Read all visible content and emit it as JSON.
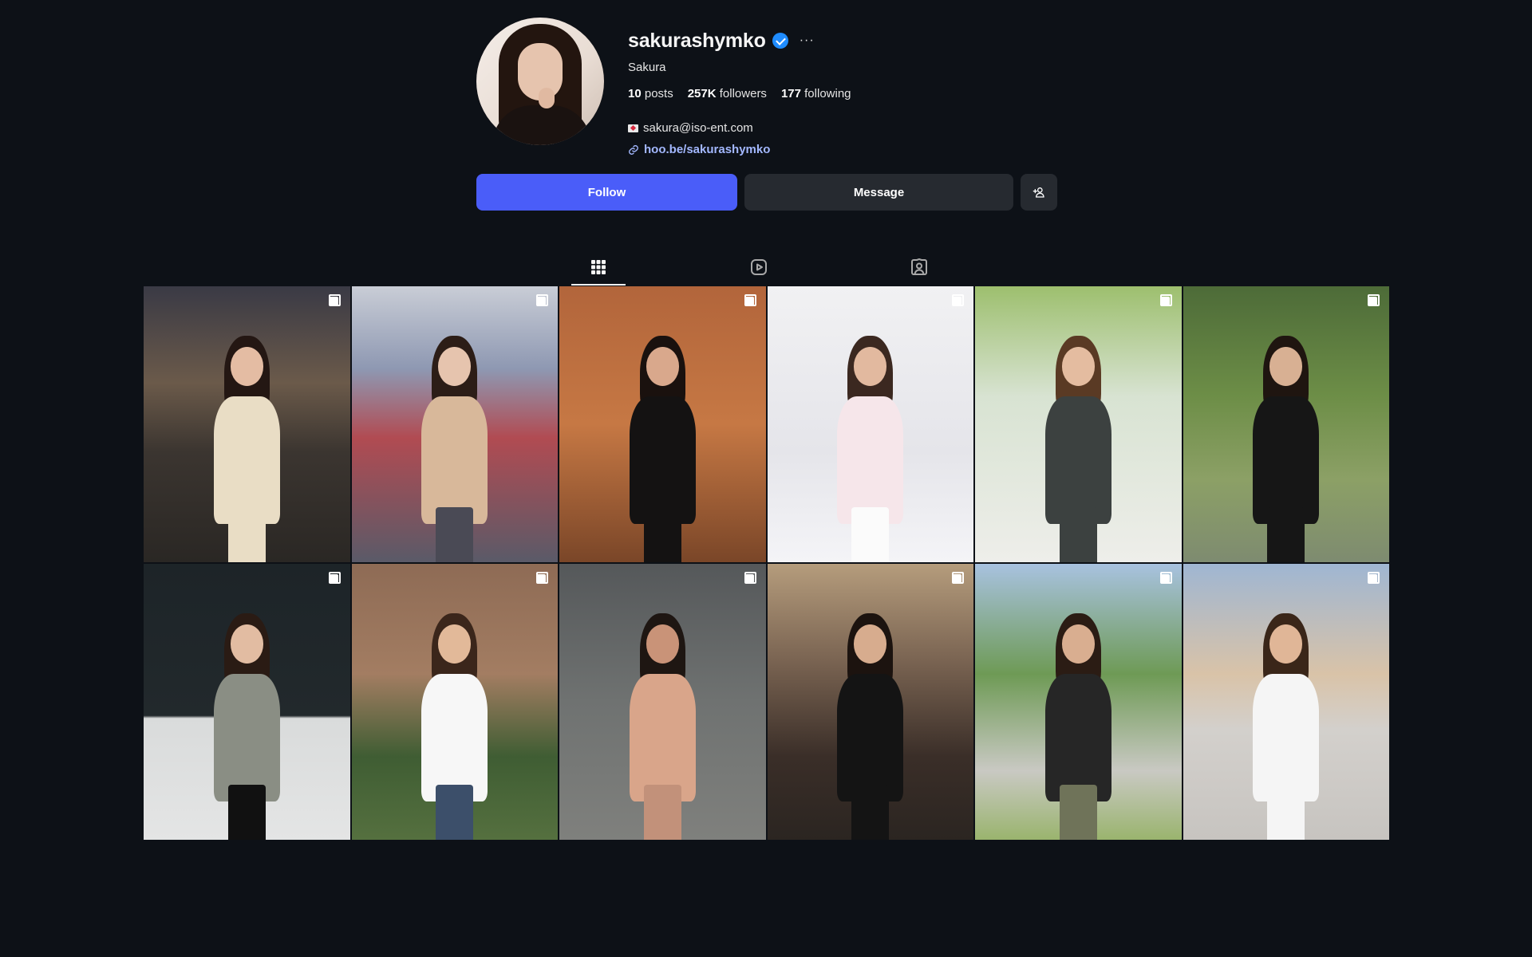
{
  "profile": {
    "username": "sakurashymko",
    "full_name": "Sakura",
    "more_label": "···",
    "stats": {
      "posts_count": "10",
      "posts_label": "posts",
      "followers_count": "257K",
      "followers_label": "followers",
      "following_count": "177",
      "following_label": "following"
    },
    "email": "sakura@iso-ent.com",
    "link": "hoo.be/sakurashymko"
  },
  "actions": {
    "follow_label": "Follow",
    "message_label": "Message"
  },
  "tabs": [
    {
      "name": "posts",
      "icon": "grid-icon",
      "active": true
    },
    {
      "name": "reels",
      "icon": "reels-icon",
      "active": false
    },
    {
      "name": "tagged",
      "icon": "tagged-icon",
      "active": false
    }
  ],
  "colors": {
    "background": "#0d1117",
    "follow_button": "#4a5df9",
    "secondary_button": "#262a30",
    "link": "#a3b8ff",
    "verified": "#1f8cff"
  },
  "posts": [
    {
      "bg": "linear-gradient(180deg,#3a3a45 0%,#6b5a4a 35%,#3b3530 60%,#2a2724 100%)",
      "hair": "#241713",
      "skin": "#e4bca3",
      "top": "#e9ddc5",
      "bottom": "#e9ddc5",
      "multi": true
    },
    {
      "bg": "linear-gradient(180deg,#c9cdd6 0%,#8e98b2 30%,#b14b52 55%,#5a5a68 100%)",
      "hair": "#2c1d17",
      "skin": "#e6c4ae",
      "top": "#d8b89a",
      "bottom": "#4a4a55",
      "multi": true
    },
    {
      "bg": "linear-gradient(180deg,#b2653b 0%,#c67844 50%,#7a4628 100%)",
      "hair": "#1a110e",
      "skin": "#d9a88c",
      "top": "#141212",
      "bottom": "#141212",
      "multi": true
    },
    {
      "bg": "linear-gradient(180deg,#f1f1f3 0%,#e5e5ea 60%,#f4f4f7 100%)",
      "hair": "#3b2820",
      "skin": "#e2b99f",
      "top": "#f6e6ea",
      "bottom": "#fbfbfb",
      "multi": true
    },
    {
      "bg": "linear-gradient(180deg,#9dbf6e 0%,#d8e3d2 40%,#eeeeea 100%)",
      "hair": "#5a3a24",
      "skin": "#e4bca0",
      "top": "#3c4140",
      "bottom": "#3c4140",
      "multi": true
    },
    {
      "bg": "linear-gradient(180deg,#4d6b38 0%,#6d8e47 40%,#8ca066 70%,#7e8b70 100%)",
      "hair": "#1f1510",
      "skin": "#d8b093",
      "top": "#161616",
      "bottom": "#161616",
      "multi": true
    },
    {
      "bg": "linear-gradient(180deg,#1d2428 0%,#22292c 55%,#d9dbdb 56%,#e4e5e5 100%)",
      "hair": "#2a1b14",
      "skin": "#e2bca2",
      "top": "#8a8e84",
      "bottom": "#111111",
      "multi": true
    },
    {
      "bg": "linear-gradient(180deg,#8e6b55 0%,#a37d62 40%,#3f5d33 70%,#55703f 100%)",
      "hair": "#3b261b",
      "skin": "#e2b999",
      "top": "#f7f7f7",
      "bottom": "#3c4f6a",
      "multi": true
    },
    {
      "bg": "linear-gradient(180deg,#55585a 0%,#6f7271 50%,#7f807d 100%)",
      "hair": "#1e1612",
      "skin": "#c99378",
      "top": "#d9a58a",
      "bottom": "#c2917a",
      "multi": true
    },
    {
      "bg": "linear-gradient(180deg,#b59c7c 0%,#7a6452 35%,#3a2e28 70%,#2b2521 100%)",
      "hair": "#1c130f",
      "skin": "#d7ac8e",
      "top": "#141414",
      "bottom": "#141414",
      "multi": true
    },
    {
      "bg": "linear-gradient(180deg,#a8c2e0 0%,#6e9a55 40%,#c9c9c3 75%,#9ab46e 100%)",
      "hair": "#2b1c14",
      "skin": "#d9ae90",
      "top": "#262626",
      "bottom": "#6f7359",
      "multi": true
    },
    {
      "bg": "linear-gradient(180deg,#9fb6d2 0%,#d9c3a8 40%,#d3d0cc 60%,#c7c4c0 100%)",
      "hair": "#3a2619",
      "skin": "#e0b697",
      "top": "#f5f5f5",
      "bottom": "#f5f5f5",
      "multi": true
    }
  ]
}
